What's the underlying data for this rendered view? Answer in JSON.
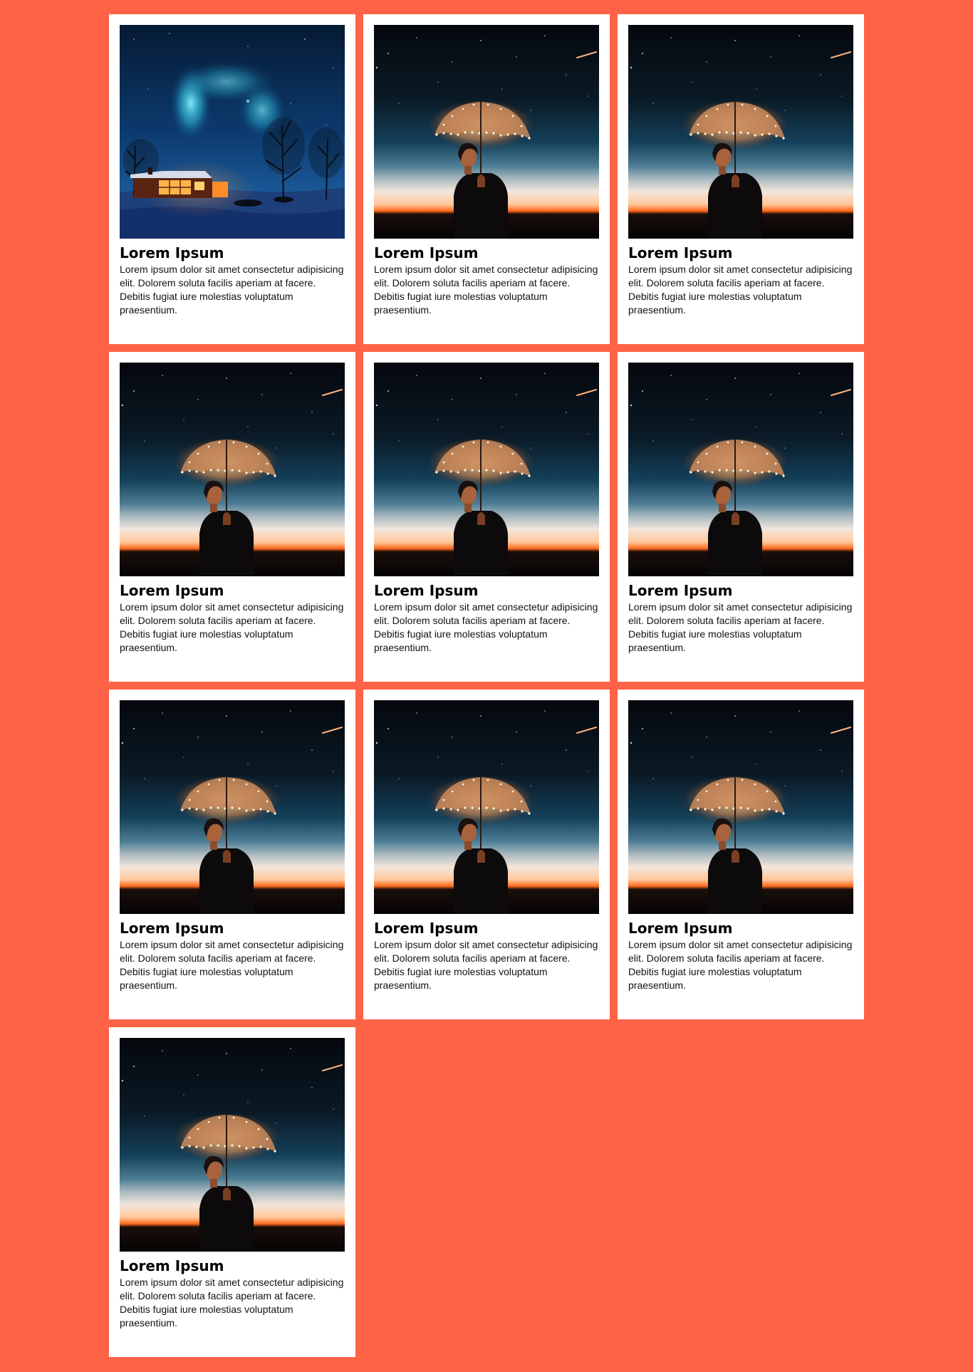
{
  "colors": {
    "background": "#ff6347",
    "card": "#ffffff",
    "title": "#000000",
    "text": "#111111"
  },
  "cards": [
    {
      "image": "aurora-house-photo",
      "title": "Lorem Ipsum",
      "text": "Lorem ipsum dolor sit amet consectetur adipisicing elit. Dolorem soluta facilis aperiam at facere. Debitis fugiat iure molestias voluptatum praesentium."
    },
    {
      "image": "umbrella-lights-photo",
      "title": "Lorem Ipsum",
      "text": "Lorem ipsum dolor sit amet consectetur adipisicing elit. Dolorem soluta facilis aperiam at facere. Debitis fugiat iure molestias voluptatum praesentium."
    },
    {
      "image": "umbrella-lights-photo",
      "title": "Lorem Ipsum",
      "text": "Lorem ipsum dolor sit amet consectetur adipisicing elit. Dolorem soluta facilis aperiam at facere. Debitis fugiat iure molestias voluptatum praesentium."
    },
    {
      "image": "umbrella-lights-photo",
      "title": "Lorem Ipsum",
      "text": "Lorem ipsum dolor sit amet consectetur adipisicing elit. Dolorem soluta facilis aperiam at facere. Debitis fugiat iure molestias voluptatum praesentium."
    },
    {
      "image": "umbrella-lights-photo",
      "title": "Lorem Ipsum",
      "text": "Lorem ipsum dolor sit amet consectetur adipisicing elit. Dolorem soluta facilis aperiam at facere. Debitis fugiat iure molestias voluptatum praesentium."
    },
    {
      "image": "umbrella-lights-photo",
      "title": "Lorem Ipsum",
      "text": "Lorem ipsum dolor sit amet consectetur adipisicing elit. Dolorem soluta facilis aperiam at facere. Debitis fugiat iure molestias voluptatum praesentium."
    },
    {
      "image": "umbrella-lights-photo",
      "title": "Lorem Ipsum",
      "text": "Lorem ipsum dolor sit amet consectetur adipisicing elit. Dolorem soluta facilis aperiam at facere. Debitis fugiat iure molestias voluptatum praesentium."
    },
    {
      "image": "umbrella-lights-photo",
      "title": "Lorem Ipsum",
      "text": "Lorem ipsum dolor sit amet consectetur adipisicing elit. Dolorem soluta facilis aperiam at facere. Debitis fugiat iure molestias voluptatum praesentium."
    },
    {
      "image": "umbrella-lights-photo",
      "title": "Lorem Ipsum",
      "text": "Lorem ipsum dolor sit amet consectetur adipisicing elit. Dolorem soluta facilis aperiam at facere. Debitis fugiat iure molestias voluptatum praesentium."
    },
    {
      "image": "umbrella-lights-photo",
      "title": "Lorem Ipsum",
      "text": "Lorem ipsum dolor sit amet consectetur adipisicing elit. Dolorem soluta facilis aperiam at facere. Debitis fugiat iure molestias voluptatum praesentium."
    }
  ]
}
